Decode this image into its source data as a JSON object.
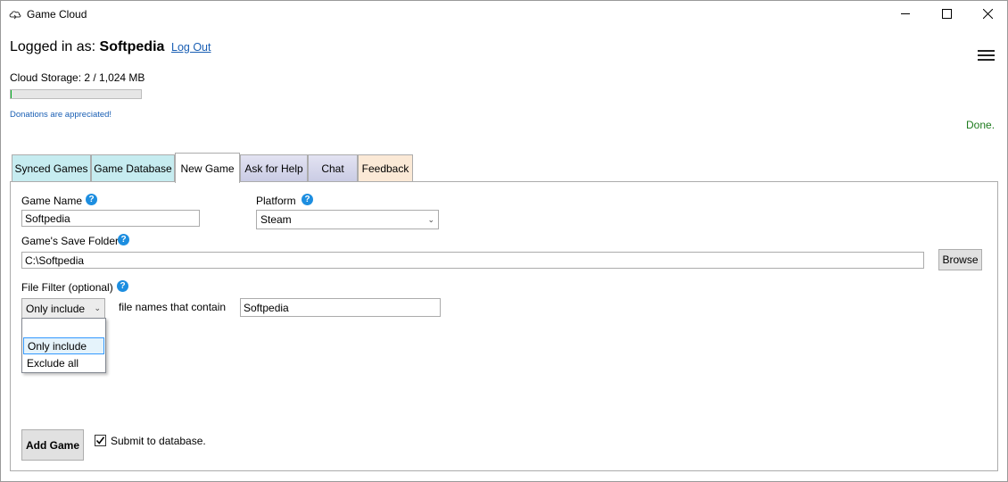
{
  "window": {
    "title": "Game Cloud"
  },
  "account": {
    "logged_in_prefix": "Logged in as:",
    "username": "Softpedia",
    "logout_label": "Log Out"
  },
  "storage": {
    "label": "Cloud Storage: 2 / 1,024 MB",
    "used_fraction": 0.002
  },
  "donations_text": "Donations are appreciated!",
  "status_text": "Done.",
  "tabs": [
    {
      "label": "Synced Games"
    },
    {
      "label": "Game Database"
    },
    {
      "label": "New Game",
      "active": true
    },
    {
      "label": "Ask for Help"
    },
    {
      "label": "Chat"
    },
    {
      "label": "Feedback"
    }
  ],
  "form": {
    "game_name_label": "Game Name",
    "game_name_value": "Softpedia",
    "platform_label": "Platform",
    "platform_value": "Steam",
    "save_folder_label": "Game's Save Folder",
    "save_folder_value": "C:\\Softpedia",
    "browse_label": "Browse",
    "file_filter_label": "File Filter (optional)",
    "filter_mode_value": "Only include",
    "filter_options": [
      "Only include",
      "Exclude all"
    ],
    "file_names_label": "file names that contain",
    "file_names_value": "Softpedia",
    "add_game_label": "Add Game",
    "submit_label": "Submit to database.",
    "submit_checked": true
  },
  "icons": {
    "app": "cloud-sync-icon",
    "help": "help-icon",
    "menu": "hamburger-menu-icon"
  },
  "colors": {
    "accent_link": "#1a5fb4",
    "status_green": "#1e7b1e",
    "help_blue": "#1d8ee0"
  }
}
